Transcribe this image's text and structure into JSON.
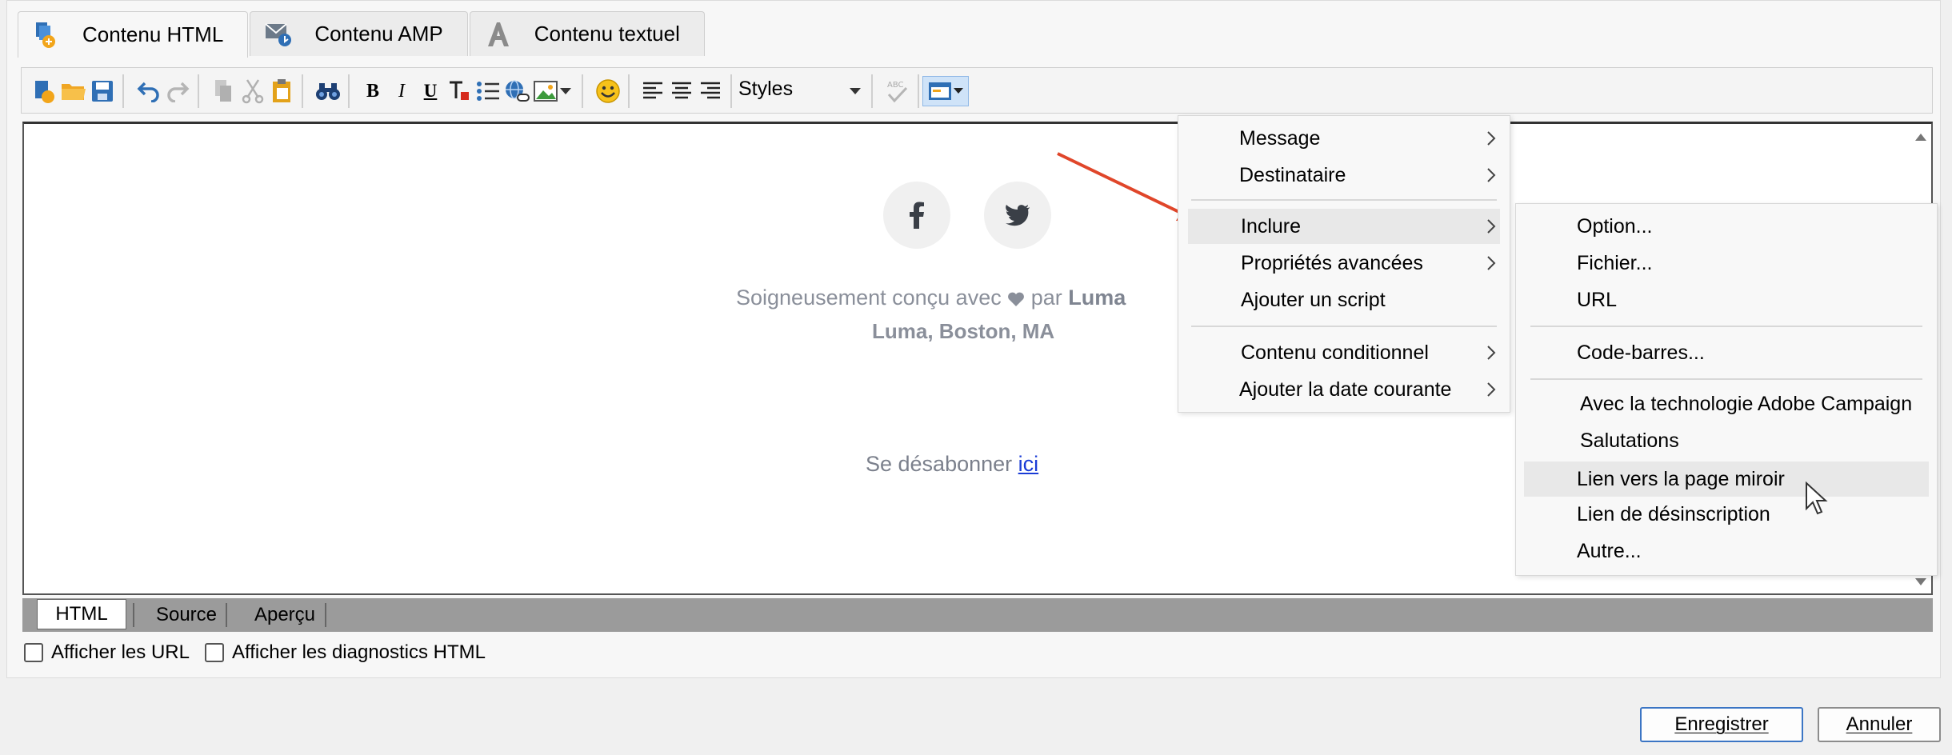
{
  "tabs": [
    {
      "label": "Contenu HTML",
      "icon": "html-content-icon",
      "active": true
    },
    {
      "label": "Contenu AMP",
      "icon": "amp-content-icon",
      "active": false
    },
    {
      "label": "Contenu textuel",
      "icon": "text-content-icon",
      "active": false
    }
  ],
  "toolbar": {
    "styles_label": "Styles"
  },
  "editor": {
    "social": [
      "facebook",
      "twitter"
    ],
    "footer_text_before": "Soigneusement conçu avec",
    "footer_text_par": " par ",
    "footer_brand": "Luma",
    "footer_address": "Luma, Boston, MA",
    "unsubscribe_text": "Se désabonner ",
    "unsubscribe_link": "ici "
  },
  "view_tabs": [
    {
      "label": "HTML",
      "active": true
    },
    {
      "label": "Source",
      "active": false
    },
    {
      "label": "Aperçu",
      "active": false
    }
  ],
  "options": {
    "show_urls": "Afficher les URL",
    "show_diagnostics": "Afficher les diagnostics HTML"
  },
  "buttons": {
    "save": "Enregistrer",
    "cancel": "Annuler"
  },
  "menu_main": {
    "items": [
      {
        "label": "Message",
        "submenu": true
      },
      {
        "label": "Destinataire",
        "submenu": true
      },
      {
        "label": "Inclure",
        "submenu": true,
        "highlighted": true
      },
      {
        "label": "Propriétés avancées",
        "submenu": true
      },
      {
        "label": "Ajouter un script",
        "submenu": false
      },
      {
        "label": "Contenu conditionnel",
        "submenu": true
      },
      {
        "label": "Ajouter la date courante",
        "submenu": true
      }
    ]
  },
  "menu_include": {
    "items": [
      {
        "label": "Option..."
      },
      {
        "label": "Fichier..."
      },
      {
        "label": "URL"
      },
      {
        "label": "Code-barres..."
      },
      {
        "label": "Avec la technologie Adobe Campaign"
      },
      {
        "label": "Salutations"
      },
      {
        "label": "Lien vers la page miroir",
        "highlighted": true
      },
      {
        "label": "Lien de désinscription"
      },
      {
        "label": "Autre..."
      }
    ]
  },
  "colors": {
    "annotation_arrow": "#e0462a",
    "link": "#1a3cd6",
    "primary_button_border": "#3b75c4"
  }
}
